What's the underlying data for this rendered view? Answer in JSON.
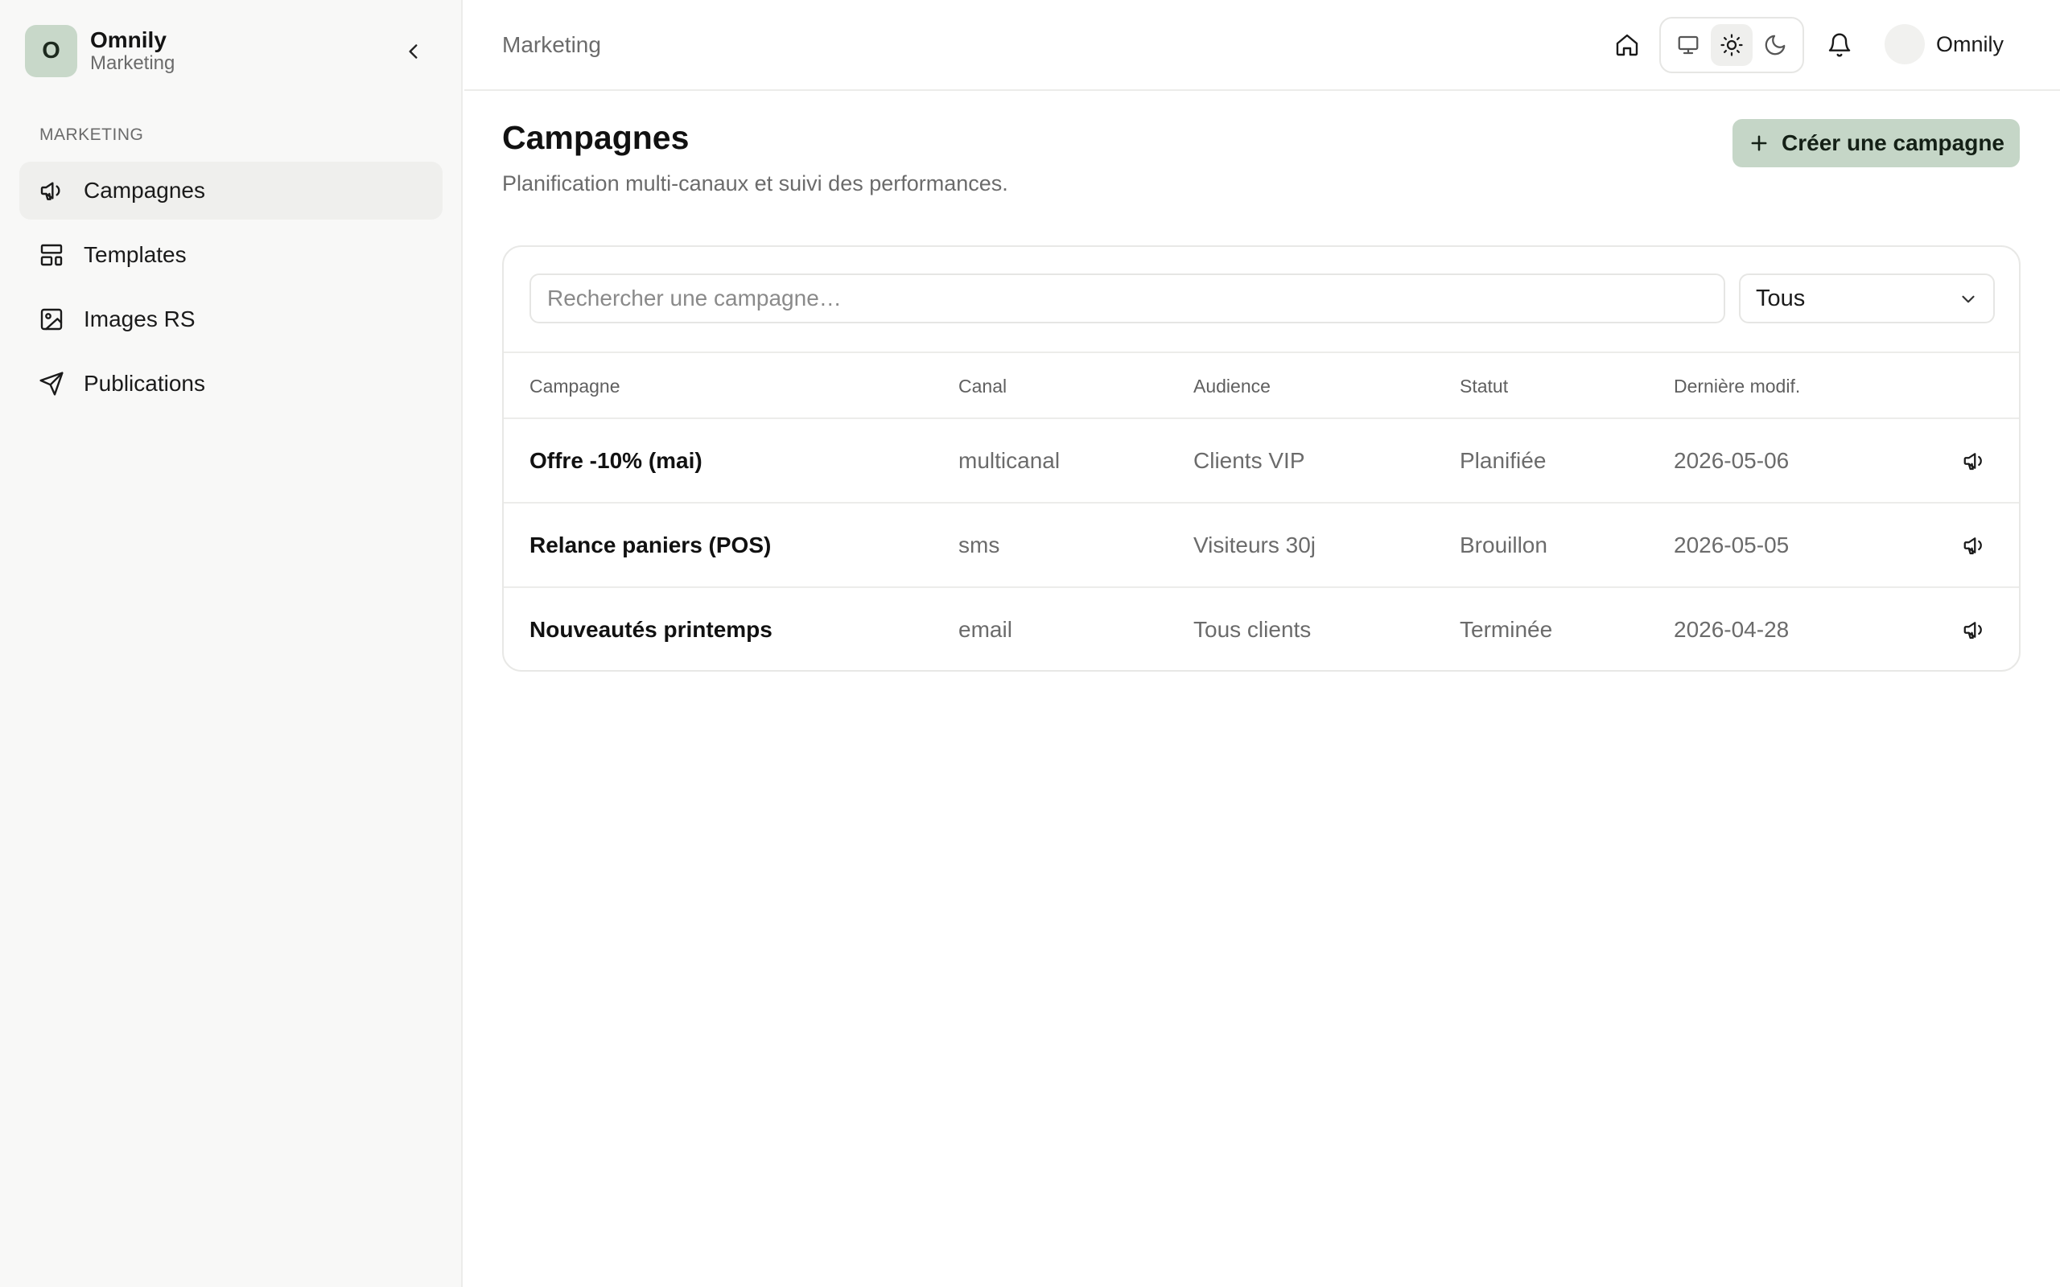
{
  "sidebar": {
    "brand": {
      "initial": "O",
      "name": "Omnily",
      "subtitle": "Marketing"
    },
    "section_label": "MARKETING",
    "items": [
      {
        "label": "Campagnes",
        "icon": "megaphone-icon",
        "active": true
      },
      {
        "label": "Templates",
        "icon": "layout-template-icon",
        "active": false
      },
      {
        "label": "Images RS",
        "icon": "image-icon",
        "active": false
      },
      {
        "label": "Publications",
        "icon": "send-icon",
        "active": false
      }
    ]
  },
  "header": {
    "breadcrumb": "Marketing",
    "theme_options": [
      "system",
      "light",
      "dark"
    ],
    "theme_selected": "light",
    "user_name": "Omnily"
  },
  "main": {
    "title": "Campagnes",
    "description": "Planification multi-canaux et suivi des performances.",
    "create_button": "Créer une campagne",
    "search_placeholder": "Rechercher une campagne…",
    "filter_value": "Tous",
    "table": {
      "columns": [
        "Campagne",
        "Canal",
        "Audience",
        "Statut",
        "Dernière modif."
      ],
      "rows": [
        {
          "name": "Offre -10% (mai)",
          "channel": "multicanal",
          "audience": "Clients VIP",
          "status": "Planifiée",
          "updated": "2026-05-06"
        },
        {
          "name": "Relance paniers (POS)",
          "channel": "sms",
          "audience": "Visiteurs 30j",
          "status": "Brouillon",
          "updated": "2026-05-05"
        },
        {
          "name": "Nouveautés printemps",
          "channel": "email",
          "audience": "Tous clients",
          "status": "Terminée",
          "updated": "2026-04-28"
        }
      ]
    }
  },
  "colors": {
    "accent": "#c5d6c7",
    "sidebar_bg": "#f8f8f7",
    "border": "#ececea"
  }
}
